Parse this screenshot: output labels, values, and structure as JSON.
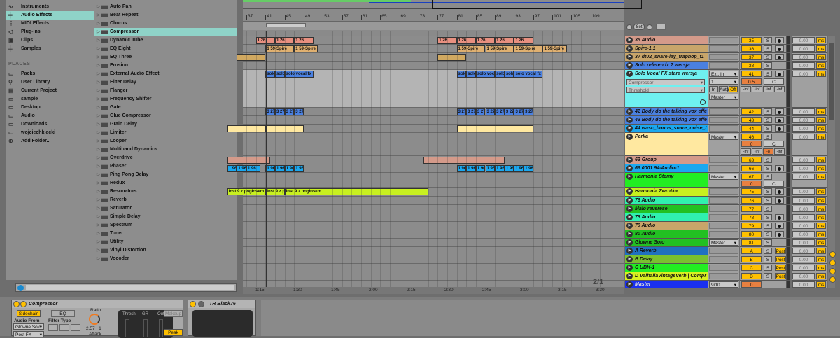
{
  "browser": {
    "categories": [
      {
        "label": "Instruments",
        "icon": "instruments-icon"
      },
      {
        "label": "Audio Effects",
        "icon": "audio-effects-icon",
        "selected": true
      },
      {
        "label": "MIDI Effects",
        "icon": "midi-effects-icon"
      },
      {
        "label": "Plug-ins",
        "icon": "plugins-icon"
      },
      {
        "label": "Clips",
        "icon": "clips-icon"
      },
      {
        "label": "Samples",
        "icon": "samples-icon"
      }
    ],
    "places_header": "PLACES",
    "places": [
      {
        "label": "Packs",
        "icon": "packs-icon"
      },
      {
        "label": "User Library",
        "icon": "user-library-icon"
      },
      {
        "label": "Current Project",
        "icon": "current-project-icon"
      },
      {
        "label": "sample",
        "icon": "folder-icon"
      },
      {
        "label": "Desktop",
        "icon": "folder-icon"
      },
      {
        "label": "Audio",
        "icon": "folder-icon"
      },
      {
        "label": "Downloads",
        "icon": "folder-icon"
      },
      {
        "label": "wojciechklecki",
        "icon": "folder-icon"
      },
      {
        "label": "Add Folder...",
        "icon": "add-folder-icon"
      }
    ],
    "items": [
      "Auto Pan",
      "Beat Repeat",
      "Chorus",
      "Compressor",
      "Dynamic Tube",
      "EQ Eight",
      "EQ Three",
      "Erosion",
      "External Audio Effect",
      "Filter Delay",
      "Flanger",
      "Frequency Shifter",
      "Gate",
      "Glue Compressor",
      "Grain Delay",
      "Limiter",
      "Looper",
      "Multiband Dynamics",
      "Overdrive",
      "Phaser",
      "Ping Pong Delay",
      "Redux",
      "Resonators",
      "Reverb",
      "Saturator",
      "Simple Delay",
      "Spectrum",
      "Tuner",
      "Utility",
      "Vinyl Distortion",
      "Vocoder"
    ],
    "selected_item": "Compressor",
    "search_value": ""
  },
  "arrangement": {
    "bars": [
      "37",
      "41",
      "45",
      "49",
      "53",
      "57",
      "61",
      "65",
      "69",
      "73",
      "77",
      "81",
      "85",
      "89",
      "93",
      "97",
      "101",
      "105",
      "109"
    ],
    "times": [
      "1:15",
      "1:30",
      "1:45",
      "2:00",
      "2:15",
      "2:30",
      "2:45",
      "3:00",
      "3:15",
      "3:30"
    ],
    "zoom_label": "2/1",
    "set_label": "Set"
  },
  "tracks": [
    {
      "name": "35 Audio",
      "color": "#d49a8a",
      "num": "35",
      "arm": true,
      "clip": "1 26"
    },
    {
      "name": "Spire-1.1",
      "color": "#c8a56a",
      "num": "36",
      "arm": true,
      "clip": "1 59-Spire"
    },
    {
      "name": "37 dt02_snare-lay_traphop_t1",
      "color": "#c8a56a",
      "num": "37",
      "arm": true
    },
    {
      "name": "Solo referen fx 2 wersja",
      "color": "#4a80e0",
      "num": "38",
      "arm": false
    },
    {
      "name": "Solo Vocal FX stara wersja",
      "color": "#6ff0f0",
      "num": "41",
      "arm": true,
      "clip": "solo vocal fx",
      "expanded": {
        "input": "Ext. In",
        "channel": "1",
        "device": "Compressor",
        "param": "Threshold",
        "monitor": [
          "In",
          "Auto",
          "Off"
        ],
        "pan": "0.5",
        "pan_c": "C",
        "inf": [
          "-inf",
          "-inf",
          "-inf",
          "-inf"
        ],
        "output": "Master"
      }
    },
    {
      "name": "42 Body do the talking vox effe",
      "color": "#4a80e0",
      "num": "42",
      "arm": true,
      "clip": "3 27"
    },
    {
      "name": "43 Body do the talking vox effe",
      "color": "#4a80e0",
      "num": "43",
      "arm": true
    },
    {
      "name": "44 wasc_bonus_snare_noise_t",
      "color": "#1aa8f0",
      "num": "44",
      "arm": true
    },
    {
      "name": "Perka",
      "color": "#ffe8a0",
      "num": "46",
      "arm": false,
      "io": "Master",
      "group": {
        "vol": "0",
        "pan": "C",
        "inf": [
          "-inf",
          "-inf",
          "-8",
          "-inf"
        ]
      }
    },
    {
      "name": "63 Group",
      "color": "#d49a8a",
      "num": "63",
      "arm": false
    },
    {
      "name": "66 0001 94-Audio-1",
      "color": "#1aa8f0",
      "num": "66",
      "arm": true,
      "clip": "1 96"
    },
    {
      "name": "Harmonia Stemy",
      "color": "#22ee22",
      "num": "67",
      "arm": false,
      "io": "Master",
      "group": {
        "vol": "0",
        "pan": "C"
      }
    },
    {
      "name": "Harmonia Zwrotka",
      "color": "#c8f020",
      "num": "75",
      "arm": true,
      "clip": "inst 9 z pogłosem"
    },
    {
      "name": "76 Audio",
      "color": "#30f0b0",
      "num": "76",
      "arm": true
    },
    {
      "name": "Malo reverese",
      "color": "#22c022",
      "num": "77",
      "arm": false
    },
    {
      "name": "78 Audio",
      "color": "#30f0b0",
      "num": "78",
      "arm": true
    },
    {
      "name": "79 Audio",
      "color": "#c8a56a",
      "num": "79",
      "arm": true
    },
    {
      "name": "80 Audio",
      "color": "#22c022",
      "num": "80",
      "arm": true
    },
    {
      "name": "Glowne Solo",
      "color": "#22c022",
      "num": "81",
      "arm": false,
      "io": "Master"
    },
    {
      "name": "A Reverb",
      "color": "#2070c0",
      "num": "A",
      "post": "Post"
    },
    {
      "name": "B Delay",
      "color": "#7ac030",
      "num": "B",
      "post": "Post"
    },
    {
      "name": "C UBK-1",
      "color": "#22ee22",
      "num": "C",
      "post": "Post"
    },
    {
      "name": "D ValhallaVintageVerb | Compr",
      "color": "#d8f020",
      "num": "D",
      "post": "Post"
    },
    {
      "name": "Master",
      "color": "#1a30f0",
      "num": "0",
      "io": "9/10",
      "master": true
    }
  ],
  "mixer": {
    "delay": "0.00",
    "delay_unit": "ms",
    "solo": "S"
  },
  "devices": {
    "compressor": {
      "title": "Compressor",
      "sidechain": "Sidechain",
      "eq": "EQ",
      "audio_from_label": "Audio From",
      "audio_from": "Glowne Solo",
      "post_fx": "Post FX",
      "filter_type_label": "Filter Type",
      "ratio_label": "Ratio",
      "ratio": "2.57 : 1",
      "attack_label": "Attack",
      "thresh": "Thresh",
      "gr": "GR",
      "out": "Out",
      "makeup": "Makeup",
      "peak": "Peak"
    },
    "plugin": {
      "title": "TR Black76"
    }
  }
}
